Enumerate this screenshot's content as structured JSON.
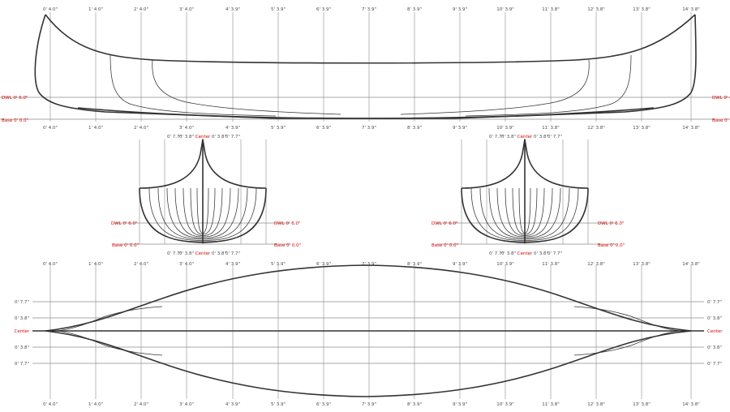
{
  "colors": {
    "background": "#ffffff",
    "grid": "#8c8c8c",
    "hull_line": "#333333",
    "reference_label": "#d80000",
    "station_label": "#4a4a4a"
  },
  "stations": [
    "0' 4.0\"",
    "1' 4.0\"",
    "2' 4.0\"",
    "3' 4.0\"",
    "4' 3.9\"",
    "5' 3.9\"",
    "6' 3.9\"",
    "7' 3.9\"",
    "8' 3.9\"",
    "9' 3.9\"",
    "10' 3.9\"",
    "11' 3.8\"",
    "12' 3.8\"",
    "13' 3.8\"",
    "14' 3.8\""
  ],
  "profile_view": {
    "dwl_label": "DWL 0' 6.0\"",
    "base_label": "Base 0' 0.0\""
  },
  "body_plans": [
    {
      "top_labels": [
        "0' 7.7\"",
        "0' 3.8\"",
        "Center",
        "0' 3.8\"",
        "0' 7.7\""
      ],
      "bottom_labels": [
        "0' 7.7\"",
        "0' 3.8\"",
        "Center",
        "0' 3.8\"",
        "0' 7.7\""
      ],
      "dwl_label": "DWL 0' 6.0\"",
      "base_label": "Base 0' 0.0\""
    },
    {
      "top_labels": [
        "0' 7.7\"",
        "0' 3.8\"",
        "Center",
        "0' 3.8\"",
        "0' 7.7\""
      ],
      "bottom_labels": [
        "0' 7.7\"",
        "0' 3.8\"",
        "Center",
        "0' 3.8\"",
        "0' 7.7\""
      ],
      "dwl_label": "DWL 0' 6.0\"",
      "base_label": "Base 0' 0.0\""
    }
  ],
  "plan_view": {
    "row_labels": [
      "0' 7.7\"",
      "0' 3.8\"",
      "Center",
      "0' 3.8\"",
      "0' 7.7\""
    ]
  }
}
